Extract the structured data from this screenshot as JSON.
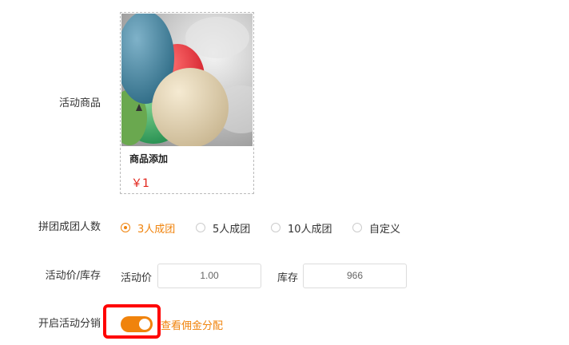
{
  "form": {
    "product_label": "活动商品",
    "group_size_label": "拼团成团人数",
    "price_stock_label": "活动价/库存",
    "distribution_label": "开启活动分销"
  },
  "product": {
    "name": "商品添加",
    "price": "￥1"
  },
  "group_options": [
    {
      "label": "3人成团",
      "selected": true
    },
    {
      "label": "5人成团",
      "selected": false
    },
    {
      "label": "10人成团",
      "selected": false
    },
    {
      "label": "自定义",
      "selected": false
    }
  ],
  "price_stock": {
    "price_label": "活动价",
    "price_value": "1.00",
    "stock_label": "库存",
    "stock_value": "966"
  },
  "distribution": {
    "enabled": true,
    "link_text": "查看佣金分配"
  },
  "colors": {
    "accent": "#f0830c",
    "price": "#e2231a",
    "highlight": "#ff0000"
  }
}
